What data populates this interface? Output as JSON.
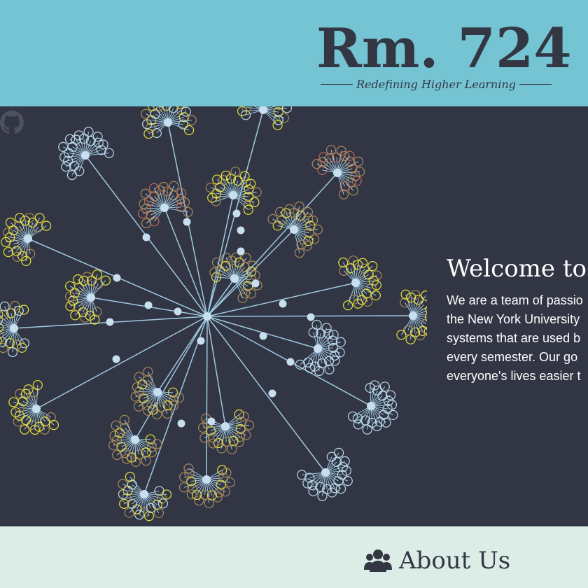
{
  "header": {
    "logo": "Rm. 724",
    "tagline": "Redefining Higher Learning"
  },
  "hero": {
    "github_icon": "github-icon",
    "welcome_title": "Welcome to",
    "welcome_lines": [
      "We are a team of passio",
      "the New York University",
      "systems that are used b",
      "every semester. Our go",
      "everyone's lives easier t"
    ]
  },
  "about": {
    "icon": "users-icon",
    "title": "About Us"
  },
  "colors": {
    "header_bg": "#75c4d3",
    "hero_bg": "#323544",
    "about_bg": "#dbede6",
    "text_dark": "#333744",
    "graph_edge": "#9fc9e0",
    "graph_node": "#c8dff0",
    "leaf_blue": "#b9d9ea",
    "leaf_yellow": "#e3e237",
    "leaf_tan": "#a68a5c",
    "leaf_red": "#c0685a"
  }
}
